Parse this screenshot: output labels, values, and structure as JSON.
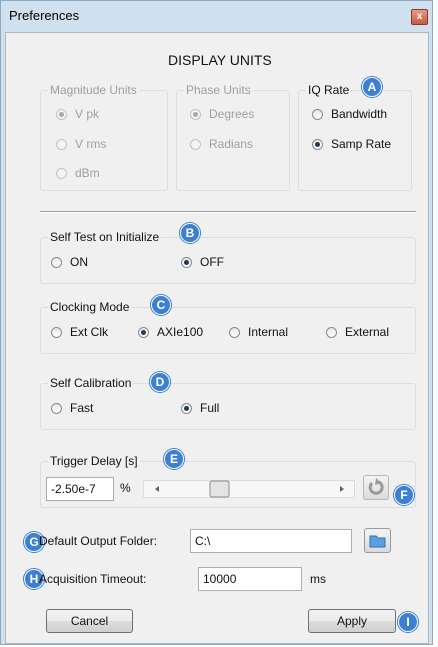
{
  "window": {
    "title": "Preferences",
    "close_glyph": "x"
  },
  "display_units": {
    "heading": "DISPLAY UNITS",
    "magnitude": {
      "title": "Magnitude Units",
      "options": [
        "V pk",
        "V rms",
        "dBm"
      ],
      "selected": "V pk"
    },
    "phase": {
      "title": "Phase Units",
      "options": [
        "Degrees",
        "Radians"
      ],
      "selected": "Degrees"
    },
    "iq_rate": {
      "title": "IQ Rate",
      "badge": "A",
      "options": [
        "Bandwidth",
        "Samp Rate"
      ],
      "selected": "Samp Rate"
    }
  },
  "self_test": {
    "title": "Self Test on Initialize",
    "badge": "B",
    "options": [
      "ON",
      "OFF"
    ],
    "selected": "OFF"
  },
  "clocking": {
    "title": "Clocking Mode",
    "badge": "C",
    "options": [
      "Ext Clk",
      "AXIe100",
      "Internal",
      "External"
    ],
    "selected": "AXIe100"
  },
  "self_cal": {
    "title": "Self Calibration",
    "badge": "D",
    "options": [
      "Fast",
      "Full"
    ],
    "selected": "Full"
  },
  "trigger_delay": {
    "title": "Trigger Delay [s]",
    "badge": "E",
    "value": "-2.50e-7",
    "unit": "%",
    "reset_badge": "F"
  },
  "output_folder": {
    "badge": "G",
    "label": "Default Output Folder:",
    "value": "C:\\"
  },
  "acq_timeout": {
    "badge": "H",
    "label": "Acquisition Timeout:",
    "value": "10000",
    "unit": "ms"
  },
  "buttons": {
    "cancel": "Cancel",
    "apply": "Apply",
    "apply_badge": "I"
  },
  "colors": {
    "badge": "#3d7fd0",
    "client_bg": "#f0f0f0",
    "frame_bg": "#cfe0ef",
    "close_button": "#c45a40"
  }
}
